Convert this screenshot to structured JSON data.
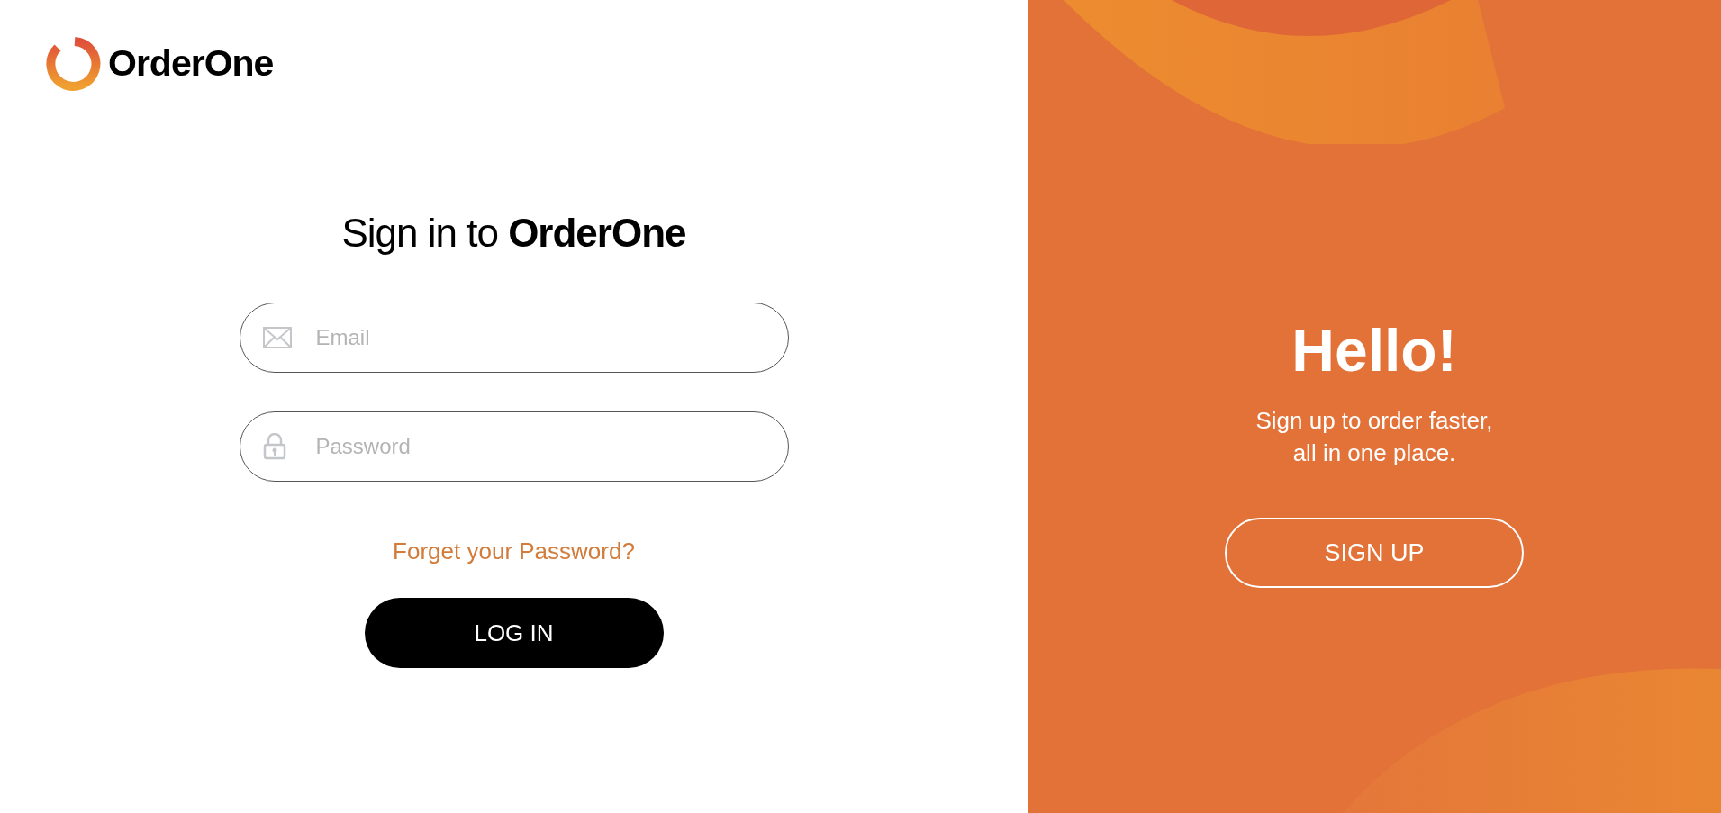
{
  "brand": {
    "name": "OrderOne"
  },
  "login": {
    "heading": "Sign in to **OrderOne**",
    "fields": [
      {
        "kind": "email",
        "placeholder": "Email"
      },
      {
        "kind": "password",
        "placeholder": "Password"
      }
    ],
    "forgot_link": "Forget your Password?",
    "submit": "LOG IN"
  },
  "promo": {
    "heading": "Hello!",
    "lines": [
      "Sign up to order faster,",
      "all in one place."
    ],
    "button": "SIGN UP"
  }
}
